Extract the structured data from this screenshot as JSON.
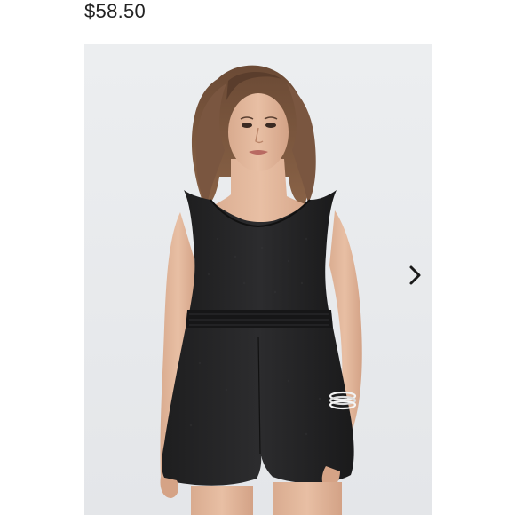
{
  "product": {
    "price": "$58.50"
  },
  "gallery": {
    "image_subject": "model-in-black-sleeveless-romper",
    "background_color": "#e9ebed",
    "next_icon": "chevron-right-icon"
  }
}
